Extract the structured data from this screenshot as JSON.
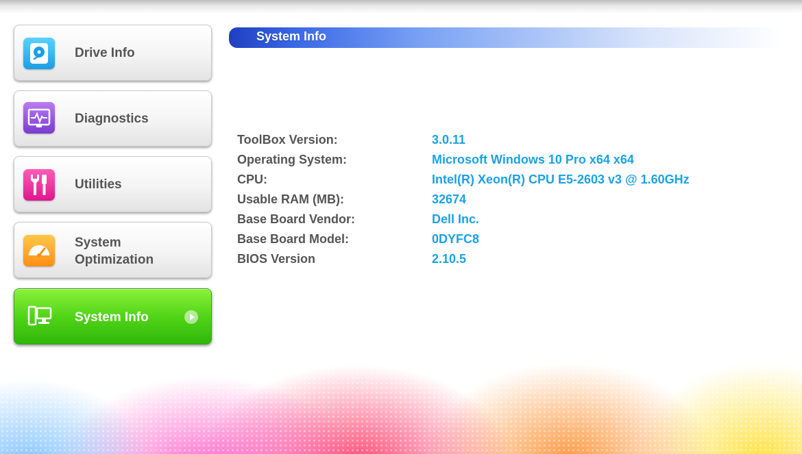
{
  "sidebar": {
    "items": [
      {
        "label": "Drive Info",
        "icon": "drive-icon"
      },
      {
        "label": "Diagnostics",
        "icon": "pulse-monitor-icon"
      },
      {
        "label": "Utilities",
        "icon": "tools-icon"
      },
      {
        "label": "System Optimization",
        "label_line1": "System",
        "label_line2": "Optimization",
        "icon": "speedometer-icon"
      },
      {
        "label": "System Info",
        "icon": "computer-icon",
        "active": true
      }
    ]
  },
  "main": {
    "section_title": "System Info",
    "info": [
      {
        "label": "ToolBox Version:",
        "value": "3.0.11"
      },
      {
        "label": "Operating System:",
        "value": "Microsoft Windows 10 Pro x64 x64"
      },
      {
        "label": "CPU:",
        "value": "Intel(R) Xeon(R) CPU E5-2603 v3 @ 1.60GHz"
      },
      {
        "label": "Usable RAM (MB):",
        "value": "32674"
      },
      {
        "label": "Base Board Vendor:",
        "value": "Dell Inc."
      },
      {
        "label": "Base Board Model:",
        "value": "0DYFC8"
      },
      {
        "label": "BIOS Version",
        "value": "2.10.5"
      }
    ]
  },
  "colors": {
    "active_green": "#52d418",
    "value_blue": "#1aa2e6",
    "header_blue": "#1f3fbf",
    "label_gray": "#555555"
  }
}
